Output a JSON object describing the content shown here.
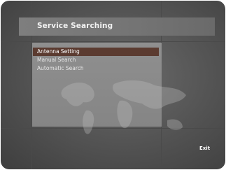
{
  "screen": {
    "title": "Service Searching",
    "menu": {
      "items": [
        {
          "label": "Antenna Setting",
          "selected": true
        },
        {
          "label": "Manual Search",
          "selected": false
        },
        {
          "label": "Automatic Search",
          "selected": false
        }
      ]
    },
    "footer": {
      "exit_label": "Exit"
    }
  },
  "colors": {
    "highlight": "#5b3b30",
    "panel": "#888888",
    "background": "#555555"
  }
}
